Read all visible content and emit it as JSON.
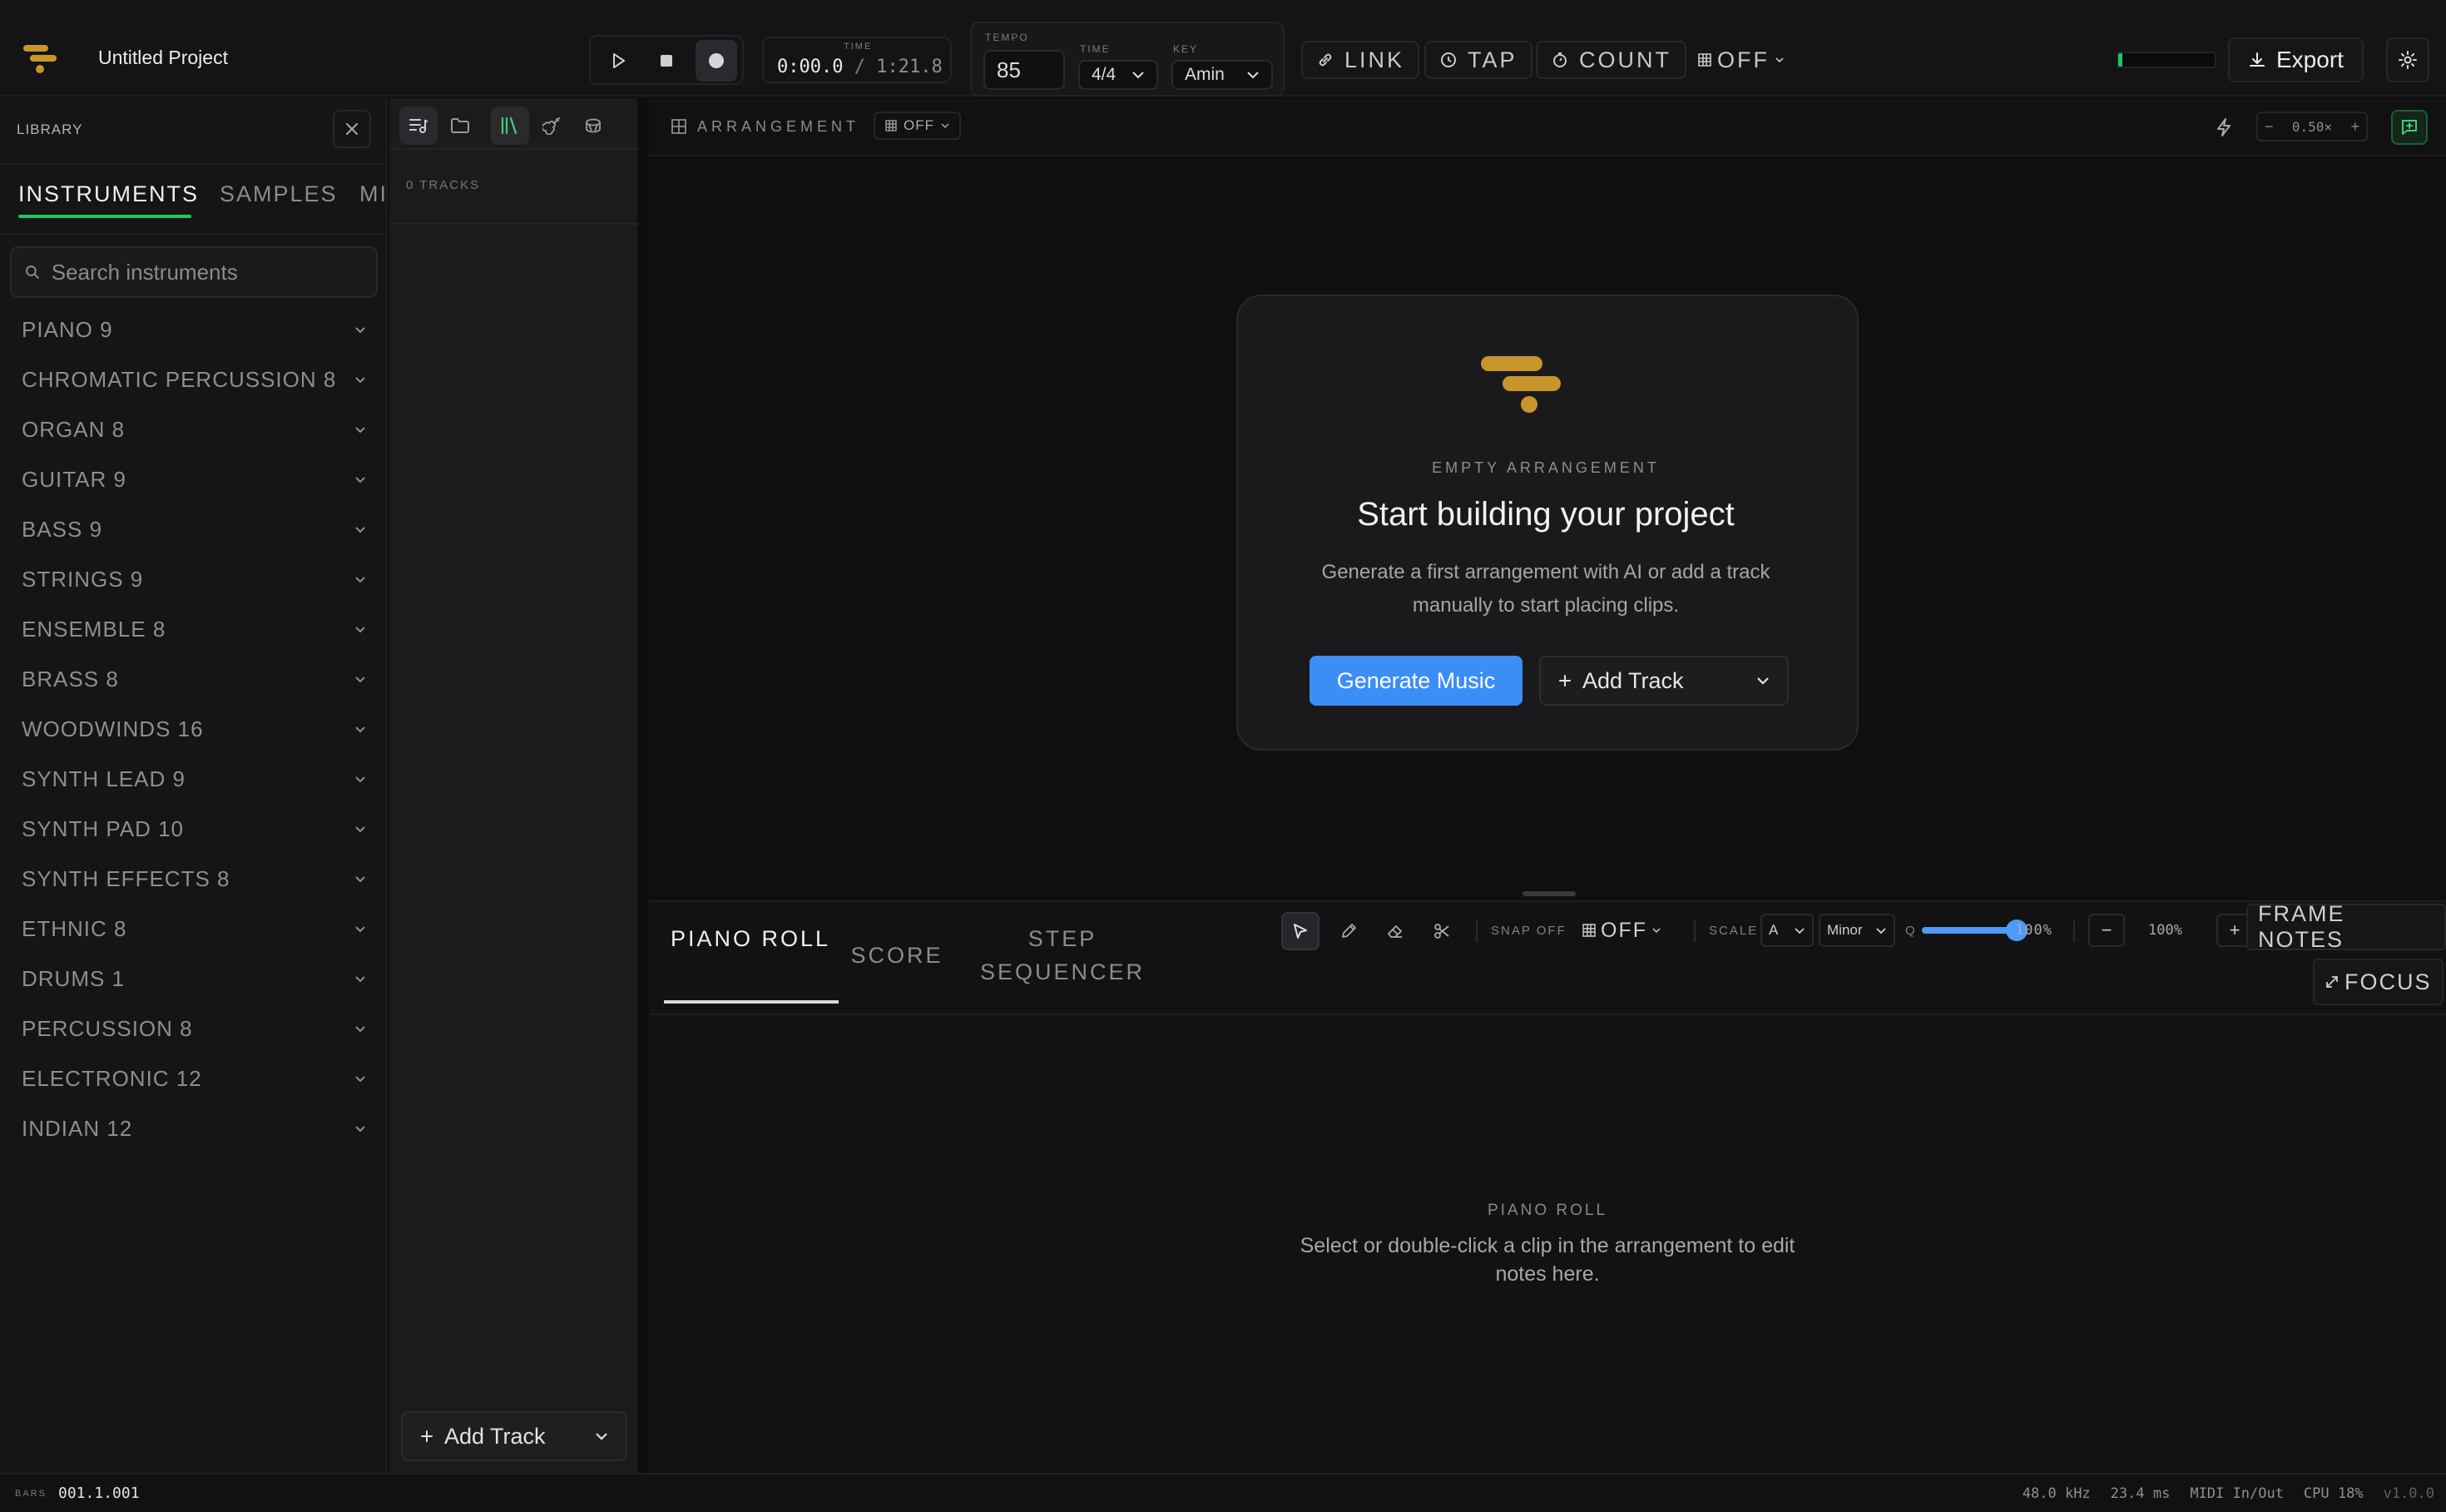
{
  "app": {
    "project_title": "Untitled Project"
  },
  "transport": {
    "time_label": "TIME",
    "time_current": "0:00.0",
    "time_sep": "/",
    "time_total": "1:21.8",
    "tempo_label": "TEMPO",
    "tempo_value": "85",
    "signature_label": "TIME",
    "signature_value": "4/4",
    "key_label": "KEY",
    "key_value": "Amin"
  },
  "toolbar": {
    "link": "LINK",
    "tap": "TAP",
    "count": "COUNT",
    "grid_off": "OFF",
    "export": "Export",
    "level_meter": 0.04
  },
  "library": {
    "title": "LIBRARY",
    "tabs": [
      "INSTRUMENTS",
      "SAMPLES",
      "MI"
    ],
    "search_placeholder": "Search instruments",
    "categories": [
      "PIANO 9",
      "CHROMATIC PERCUSSION 8",
      "ORGAN 8",
      "GUITAR 9",
      "BASS 9",
      "STRINGS 9",
      "ENSEMBLE 8",
      "BRASS 8",
      "WOODWINDS 16",
      "SYNTH LEAD 9",
      "SYNTH PAD 10",
      "SYNTH EFFECTS 8",
      "ETHNIC 8",
      "DRUMS 1",
      "PERCUSSION 8",
      "ELECTRONIC 12",
      "INDIAN 12"
    ]
  },
  "tracks": {
    "count_label": "0 TRACKS",
    "add_track": "Add Track"
  },
  "arrangement": {
    "label": "ARRANGEMENT",
    "snap": "OFF",
    "zoom": "0.50×",
    "empty": {
      "eyebrow": "EMPTY ARRANGEMENT",
      "title": "Start building your project",
      "description": "Generate a first arrangement with AI or add a track manually to start placing clips.",
      "generate_button": "Generate Music",
      "add_track_button": "Add Track"
    }
  },
  "editor": {
    "tabs": [
      "PIANO ROLL",
      "SCORE",
      "STEP SEQUENCER"
    ],
    "snap_label": "SNAP OFF",
    "grid_off": "OFF",
    "scale_label": "SCALE",
    "scale_root": "A",
    "scale_mode": "Minor",
    "q_label": "Q",
    "q_value": "100%",
    "q_fraction": 1.0,
    "zoom": "100%",
    "frame_notes": "FRAME NOTES",
    "focus": "FOCUS",
    "empty": {
      "eyebrow": "PIANO ROLL",
      "description": "Select or double-click a clip in the arrangement to edit notes here."
    }
  },
  "status": {
    "bars_label": "BARS",
    "bars_value": "001.1.001",
    "sample_rate": "48.0 kHz",
    "latency": "23.4 ms",
    "midi": "MIDI In/Out",
    "cpu": "CPU 18%",
    "version": "v1.0.0"
  },
  "colors": {
    "accent_green": "#22c55e",
    "accent_blue": "#3b8ef5",
    "logo_gold": "#c8952c"
  }
}
